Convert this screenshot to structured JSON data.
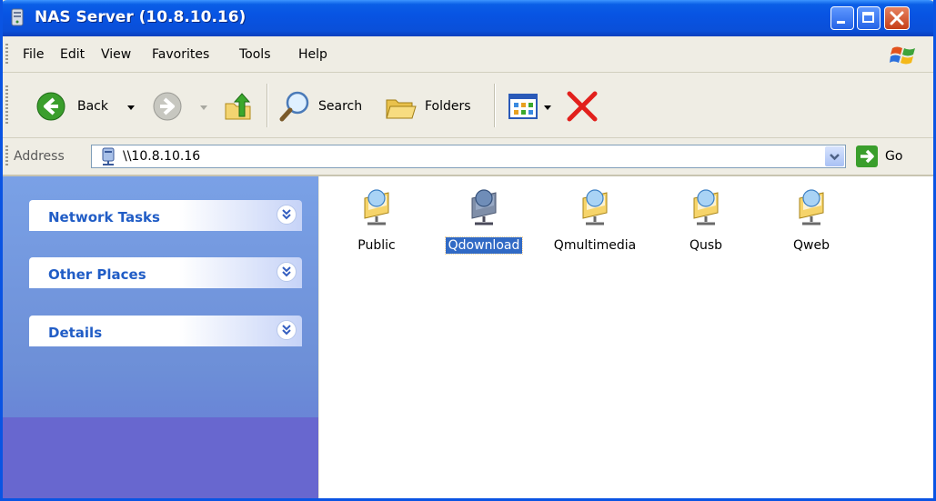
{
  "window": {
    "title": "NAS Server (10.8.10.16)"
  },
  "menu": {
    "items": [
      "File",
      "Edit",
      "View",
      "Favorites",
      "Tools",
      "Help"
    ]
  },
  "toolbar": {
    "back_label": "Back",
    "search_label": "Search",
    "folders_label": "Folders"
  },
  "address": {
    "label": "Address",
    "value": "\\\\10.8.10.16",
    "go_label": "Go"
  },
  "taskpane": {
    "panels": [
      "Network Tasks",
      "Other Places",
      "Details"
    ]
  },
  "content": {
    "folders": [
      {
        "label": "Public",
        "selected": false
      },
      {
        "label": "Qdownload",
        "selected": true
      },
      {
        "label": "Qmultimedia",
        "selected": false
      },
      {
        "label": "Qusb",
        "selected": false
      },
      {
        "label": "Qweb",
        "selected": false
      }
    ]
  },
  "colors": {
    "titlebar": "#0854e3",
    "taskpane": "#6d8fd7",
    "panel_title": "#215dc6",
    "selection": "#316ac5"
  }
}
